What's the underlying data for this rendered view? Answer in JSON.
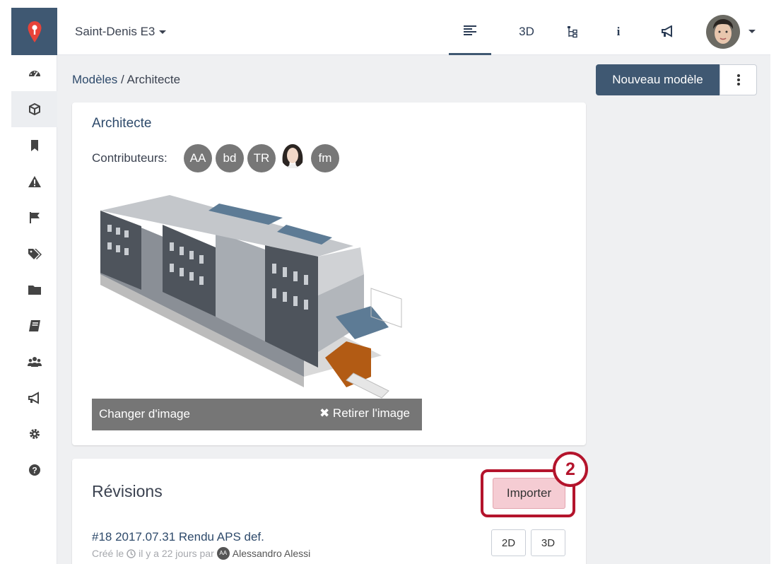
{
  "topbar": {
    "project_name": "Saint-Denis E3",
    "nav": [
      {
        "name": "list",
        "label": ""
      },
      {
        "name": "3d",
        "label": "3D"
      },
      {
        "name": "tree",
        "label": ""
      },
      {
        "name": "info",
        "label": "i"
      },
      {
        "name": "announce",
        "label": ""
      }
    ]
  },
  "sidebar": {
    "items": [
      {
        "icon": "dashboard-icon"
      },
      {
        "icon": "cube-icon",
        "active": true
      },
      {
        "icon": "bookmark-icon"
      },
      {
        "icon": "warning-icon"
      },
      {
        "icon": "flag-icon"
      },
      {
        "icon": "tags-icon"
      },
      {
        "icon": "folder-icon"
      },
      {
        "icon": "book-icon"
      },
      {
        "icon": "users-icon"
      },
      {
        "icon": "bullhorn-icon"
      },
      {
        "icon": "gear-icon"
      },
      {
        "icon": "help-icon"
      }
    ]
  },
  "breadcrumb": {
    "parent": "Modèles",
    "separator": " / ",
    "current": "Architecte"
  },
  "actions": {
    "new_model": "Nouveau modèle"
  },
  "model": {
    "title": "Architecte",
    "contributors_label": "Contributeurs:",
    "contributors": [
      "AA",
      "bd",
      "TR",
      "fm"
    ],
    "change_image": "Changer d'image",
    "remove_image": "✖ Retirer l'image"
  },
  "revisions": {
    "title": "Révisions",
    "import_label": "Importer",
    "annotation_number": "2",
    "items": [
      {
        "name": "#18 2017.07.31 Rendu APS def.",
        "created_prefix": "Créé le",
        "created_when": "il y a 22 jours par",
        "author_initials": "AA",
        "author": "Alessandro Alessi",
        "btn_2d": "2D",
        "btn_3d": "3D"
      }
    ]
  },
  "colors": {
    "brand": "#3f5872",
    "highlight": "#b4142c",
    "import_bg": "#f5ccd3"
  }
}
